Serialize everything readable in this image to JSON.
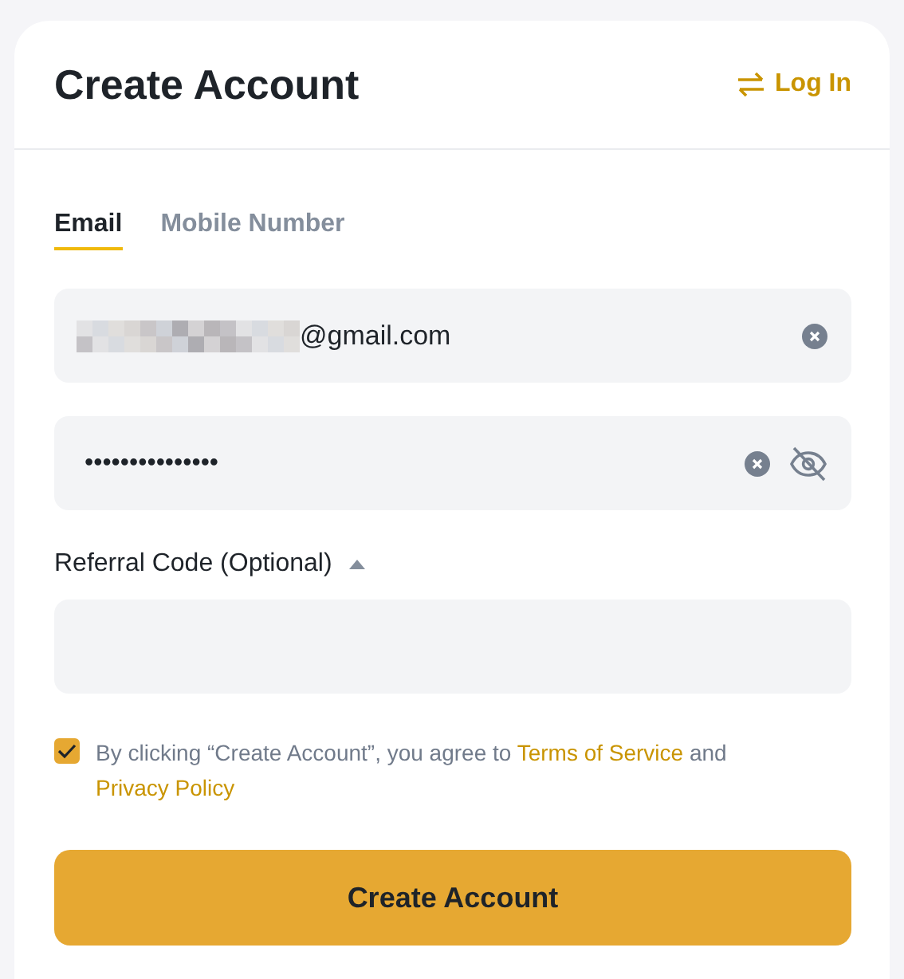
{
  "title": "Create Account",
  "login_link": {
    "label": "Log In"
  },
  "tabs": [
    {
      "label": "Email",
      "selected": true
    },
    {
      "label": "Mobile Number",
      "selected": false
    }
  ],
  "email_field": {
    "value": "@gmail.com",
    "redacted": true
  },
  "password_field": {
    "value": "•••••••••••••••",
    "visible": false
  },
  "referral": {
    "label": "Referral Code (Optional)",
    "expanded": true
  },
  "agreement": {
    "checked": true,
    "parts": [
      {
        "kind": "text",
        "text": "By clicking “Create Account”, you agree to "
      },
      {
        "kind": "link",
        "text": "Terms of Service"
      },
      {
        "kind": "text",
        "text": " and "
      },
      {
        "kind": "link",
        "text": "Privacy Policy"
      }
    ]
  },
  "submit_button": {
    "label": "Create Account"
  }
}
